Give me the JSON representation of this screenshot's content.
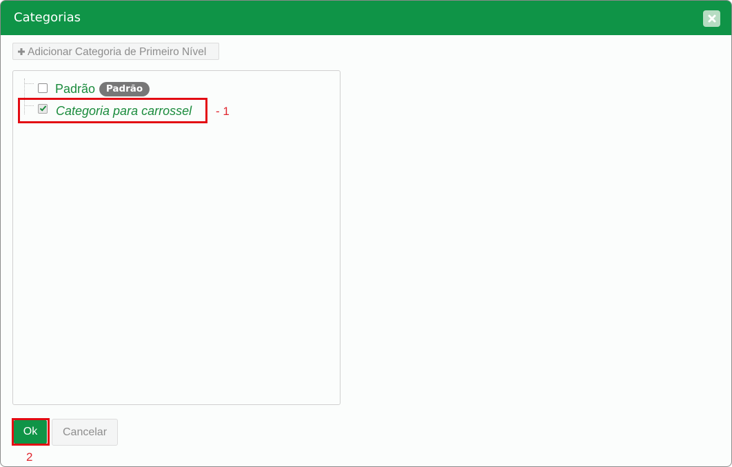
{
  "dialog": {
    "title": "Categorias",
    "close_icon": "close-icon",
    "add_button_label": "Adicionar Categoria de Primeiro Nível",
    "add_icon": "plus-icon"
  },
  "tree": {
    "items": [
      {
        "label": "Padrão",
        "checked": false,
        "badge": "Padrão",
        "italic": false
      },
      {
        "label": "Categoria para carrossel",
        "checked": true,
        "italic": true
      }
    ]
  },
  "annotations": {
    "step1": "- 1",
    "step2": "2",
    "highlight_color": "#e30b13"
  },
  "footer": {
    "ok_label": "Ok",
    "cancel_label": "Cancelar"
  },
  "colors": {
    "brand_green": "#0f9447",
    "label_green": "#1a8b3c",
    "badge_gray": "#777777"
  }
}
